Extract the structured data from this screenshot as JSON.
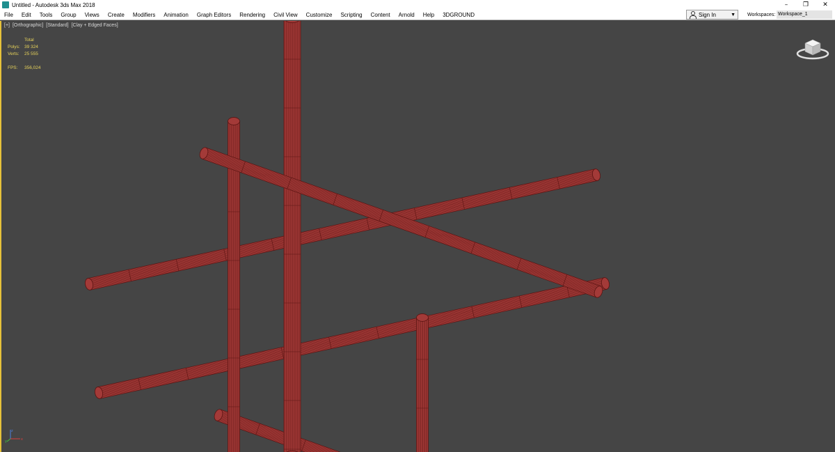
{
  "window": {
    "title": "Untitled - Autodesk 3ds Max 2018",
    "controls": [
      "–",
      "❐",
      "✕"
    ]
  },
  "menubar": {
    "items": [
      "File",
      "Edit",
      "Tools",
      "Group",
      "Views",
      "Create",
      "Modifiers",
      "Animation",
      "Graph Editors",
      "Rendering",
      "Civil View",
      "Customize",
      "Scripting",
      "Content",
      "Arnold",
      "Help",
      "3DGROUND"
    ]
  },
  "account": {
    "signin_label": "Sign In",
    "workspaces_label": "Workspaces:",
    "workspace_value": "Workspace_1"
  },
  "viewport": {
    "label_parts": [
      "[+]",
      "[Orthographic]",
      "[Standard]",
      "[Clay + Edged Faces]"
    ],
    "stats": {
      "header": "Total",
      "polys_label": "Polys:",
      "polys_value": "39 324",
      "verts_label": "Verts:",
      "verts_value": "25 555",
      "fps_label": "FPS:",
      "fps_value": "356,024"
    },
    "axis_labels": {
      "x": "x",
      "y": "y",
      "z": "z"
    }
  },
  "colors": {
    "viewport_bg": "#454545",
    "pipe_fill": "#a33a38",
    "pipe_wire": "#5a1412",
    "active_border": "#e7c23a",
    "stats_text": "#e8d35a"
  }
}
